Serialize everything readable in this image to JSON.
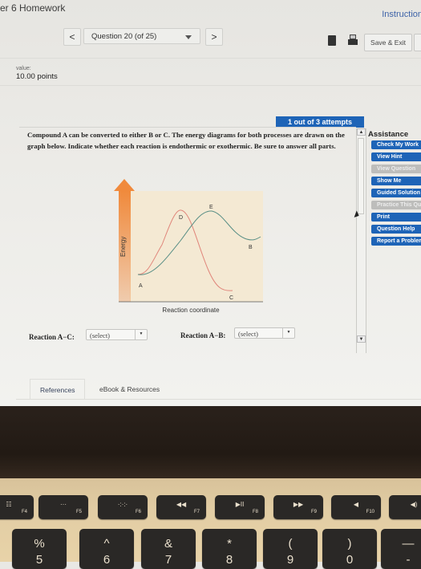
{
  "header": {
    "course_title": "er 6 Homework",
    "instructions_link": "Instruction",
    "prev_label": "<",
    "next_label": ">",
    "question_selector": "Question 20 (of 25)",
    "save_exit_label": "Save & Exit",
    "icons": [
      "book-icon",
      "print-icon"
    ]
  },
  "question_meta": {
    "value_label": "value:",
    "points": "10.00 points",
    "attempts": "1 out of 3 attempts"
  },
  "question": {
    "text": "Compound A can be converted to either B or C. The energy diagrams for both processes are drawn on the graph below. Indicate whether each reaction is endothermic or exothermic. Be sure to answer all parts."
  },
  "diagram": {
    "y_axis_label": "Energy",
    "x_axis_label": "Reaction coordinate",
    "point_labels": {
      "A": "A",
      "B": "B",
      "C": "C",
      "D": "D",
      "E": "E"
    },
    "colors": {
      "arrow": "#f08a3c",
      "background": "#f4e9d3",
      "curve_ac": "#e0857a",
      "curve_ab": "#5a8f86"
    }
  },
  "answers": {
    "reaction_ac_label": "Reaction A−C:",
    "reaction_ac_value": "(select)",
    "reaction_ab_label": "Reaction A−B:",
    "reaction_ab_value": "(select)"
  },
  "assistance": {
    "title": "Assistance",
    "buttons": [
      {
        "label": "Check My Work",
        "enabled": true
      },
      {
        "label": "View Hint",
        "enabled": true
      },
      {
        "label": "View Question",
        "enabled": false
      },
      {
        "label": "Show Me",
        "enabled": true
      },
      {
        "label": "Guided Solution",
        "enabled": true
      },
      {
        "label": "Practice This Question",
        "enabled": false
      },
      {
        "label": "Print",
        "enabled": true
      },
      {
        "label": "Question Help",
        "enabled": true
      },
      {
        "label": "Report a Problem",
        "enabled": true
      }
    ]
  },
  "tabs": [
    {
      "label": "References",
      "active": true
    },
    {
      "label": "eBook & Resources",
      "active": false
    }
  ],
  "keyboard": {
    "function_keys": [
      {
        "glyph": "☷",
        "label": "F4"
      },
      {
        "glyph": "···",
        "label": "F5"
      },
      {
        "glyph": "·:·:·",
        "label": "F6"
      },
      {
        "glyph": "◀◀",
        "label": "F7"
      },
      {
        "glyph": "▶II",
        "label": "F8"
      },
      {
        "glyph": "▶▶",
        "label": "F9"
      },
      {
        "glyph": "◀",
        "label": "F10"
      },
      {
        "glyph": "◀)",
        "label": ""
      }
    ],
    "number_keys": [
      {
        "sym": "%",
        "num": "5"
      },
      {
        "sym": "^",
        "num": "6"
      },
      {
        "sym": "&",
        "num": "7"
      },
      {
        "sym": "*",
        "num": "8"
      },
      {
        "sym": "(",
        "num": "9"
      },
      {
        "sym": ")",
        "num": "0"
      },
      {
        "sym": "—",
        "num": "-"
      }
    ]
  },
  "colors": {
    "accent_blue": "#1e64b7",
    "disabled_gray": "#bdbdbb"
  }
}
